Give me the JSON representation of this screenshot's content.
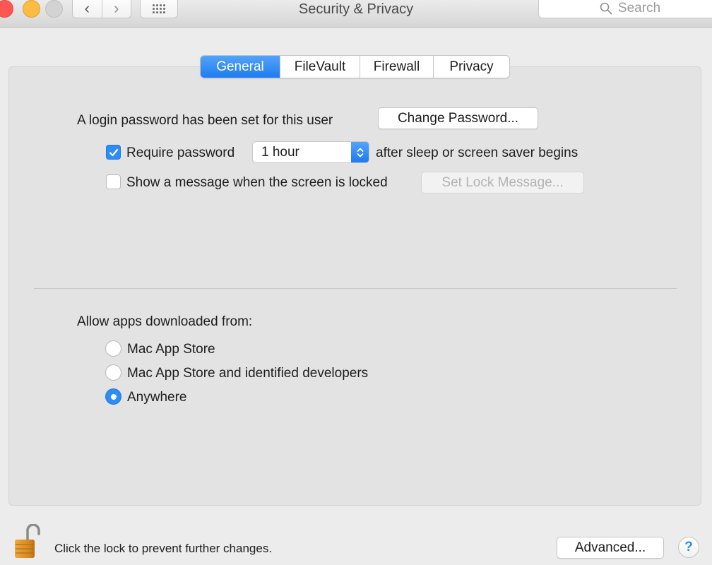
{
  "window": {
    "title": "Security & Privacy",
    "search_placeholder": "Search"
  },
  "nav": {
    "back_glyph": "‹",
    "forward_glyph": "›"
  },
  "tabs": [
    {
      "label": "General",
      "active": true
    },
    {
      "label": "FileVault",
      "active": false
    },
    {
      "label": "Firewall",
      "active": false
    },
    {
      "label": "Privacy",
      "active": false
    }
  ],
  "general": {
    "login_text": "A login password has been set for this user",
    "change_password_label": "Change Password...",
    "require_password_label": "Require password",
    "require_password_checked": true,
    "require_delay_value": "1 hour",
    "require_suffix": "after sleep or screen saver begins",
    "show_message_label": "Show a message when the screen is locked",
    "show_message_checked": false,
    "set_lock_message_label": "Set Lock Message..."
  },
  "downloads": {
    "heading": "Allow apps downloaded from:",
    "options": [
      {
        "label": "Mac App Store",
        "selected": false
      },
      {
        "label": "Mac App Store and identified developers",
        "selected": false
      },
      {
        "label": "Anywhere",
        "selected": true
      }
    ]
  },
  "footer": {
    "lock_text": "Click the lock to prevent further changes.",
    "advanced_label": "Advanced...",
    "help_label": "?"
  },
  "colors": {
    "accent": "#2d8cf5",
    "close": "#fc5753",
    "minimize": "#fdbc40",
    "maximize_disabled": "#d3d3d3"
  },
  "icons": {
    "lock": "unlocked-padlock-icon",
    "search": "magnifier-icon",
    "grid": "show-all-grid-icon"
  }
}
